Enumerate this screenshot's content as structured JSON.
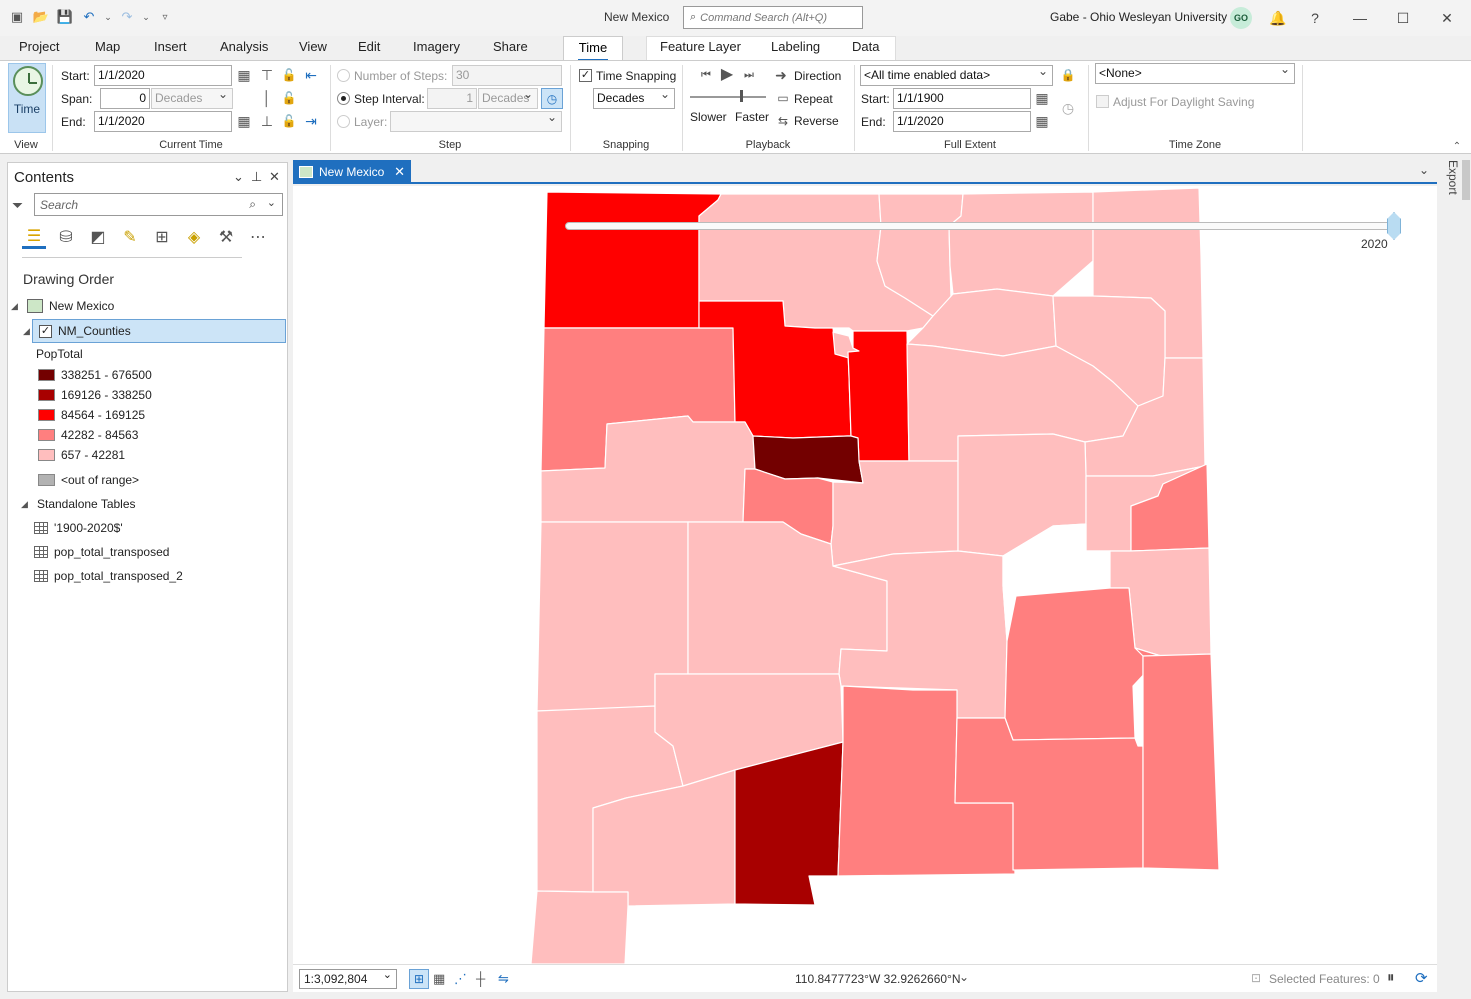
{
  "window": {
    "title": "New Mexico",
    "command_search_placeholder": "Command Search (Alt+Q)",
    "user": "Gabe - Ohio Wesleyan University",
    "user_initials": "GO"
  },
  "ribbon_tabs": [
    "Project",
    "Map",
    "Insert",
    "Analysis",
    "View",
    "Edit",
    "Imagery",
    "Share",
    "Time",
    "Feature Layer",
    "Labeling",
    "Data"
  ],
  "ribbon": {
    "view": {
      "time_button": "Time",
      "group_label": "View"
    },
    "current_time": {
      "start_label": "Start:",
      "start_value": "1/1/2020",
      "span_label": "Span:",
      "span_value": "0",
      "span_unit": "Decades",
      "end_label": "End:",
      "end_value": "1/1/2020",
      "group_label": "Current Time"
    },
    "step": {
      "num_steps_label": "Number of Steps:",
      "num_steps_value": "30",
      "step_interval_label": "Step Interval:",
      "step_interval_value": "1",
      "step_interval_unit": "Decades",
      "layer_label": "Layer:",
      "group_label": "Step"
    },
    "snapping": {
      "checkbox_label": "Time Snapping",
      "unit": "Decades",
      "group_label": "Snapping"
    },
    "playback": {
      "direction": "Direction",
      "repeat": "Repeat",
      "reverse": "Reverse",
      "slower": "Slower",
      "faster": "Faster",
      "group_label": "Playback"
    },
    "full_extent": {
      "source": "<All time enabled data>",
      "start_label": "Start:",
      "start_value": "1/1/1900",
      "end_label": "End:",
      "end_value": "1/1/2020",
      "group_label": "Full Extent"
    },
    "time_zone": {
      "value": "<None>",
      "daylight_label": "Adjust For Daylight Saving",
      "group_label": "Time Zone"
    }
  },
  "contents": {
    "title": "Contents",
    "search_placeholder": "Search",
    "drawing_order": "Drawing Order",
    "map_name": "New Mexico",
    "layer_name": "NM_Counties",
    "field_name": "PopTotal",
    "legend": [
      {
        "label": "338251 - 676500",
        "color": "#730000"
      },
      {
        "label": "169126 - 338250",
        "color": "#a80000"
      },
      {
        "label": "84564 - 169125",
        "color": "#ff0000"
      },
      {
        "label": "42282 - 84563",
        "color": "#ff7f7f"
      },
      {
        "label": "657 - 42281",
        "color": "#ffbebe"
      }
    ],
    "out_of_range": {
      "label": "<out of range>",
      "color": "#b2b2b2"
    },
    "standalone_title": "Standalone Tables",
    "tables": [
      "'1900-2020$'",
      "pop_total_transposed",
      "pop_total_transposed_2"
    ]
  },
  "map": {
    "tab_label": "New Mexico",
    "time_year": "2020",
    "scale": "1:3,092,804",
    "coordinates": "110.8477723°W 32.9262660°N",
    "selected_features": "Selected Features: 0",
    "export_label": "Export"
  },
  "colors": {
    "light": "#ffbebe",
    "medium": "#ff7f7f",
    "red": "#ff0000",
    "dark_red": "#a80000",
    "darkest": "#730000",
    "accent": "#1f6fbf"
  }
}
